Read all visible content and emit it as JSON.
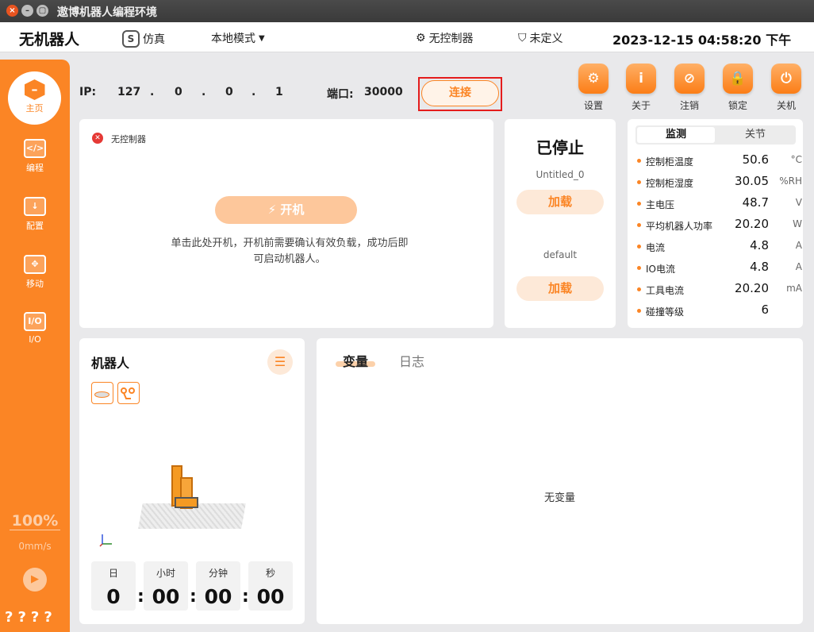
{
  "window": {
    "title": "遨博机器人编程环境",
    "close": "×",
    "minimize": "–",
    "maximize": "▢"
  },
  "header": {
    "brand": "无机器人",
    "sim_badge": "S",
    "sim": "仿真",
    "mode": "本地模式",
    "mode_caret": "▼",
    "controller_icon": "⚙",
    "controller": "无控制器",
    "safety_icon": "⛉",
    "safety": "未定义",
    "datetime": "2023-12-15 04:58:20 下午"
  },
  "sidebar": {
    "home": "主页",
    "home_glyph": "–",
    "items": [
      {
        "label": "编程",
        "glyph": "</>"
      },
      {
        "label": "配置",
        "glyph": "↓"
      },
      {
        "label": "移动",
        "glyph": "✥"
      },
      {
        "label": "I/O",
        "glyph": "I/O"
      }
    ],
    "speed_percent": "100%",
    "speed": "0mm/s",
    "play_glyph": "▶",
    "help": "????"
  },
  "connection": {
    "ip_label": "IP:",
    "ip": [
      "127",
      ".",
      "0",
      ".",
      "0",
      ".",
      "1"
    ],
    "port_label": "端口:",
    "port": "30000",
    "connect_label": "连接"
  },
  "tools": [
    {
      "label": "设置",
      "glyph": "⚙"
    },
    {
      "label": "关于",
      "glyph": "i"
    },
    {
      "label": "注销",
      "glyph": "⊘"
    },
    {
      "label": "锁定",
      "glyph": "🔒"
    },
    {
      "label": "关机",
      "glyph": "⏻"
    }
  ],
  "power_card": {
    "error_glyph": "✕",
    "error": "无控制器",
    "power_label": "⚡ 开机",
    "hint": "单击此处开机，开机前需要确认有效负载，成功后即可启动机器人。"
  },
  "state_card": {
    "state": "已停止",
    "program": "Untitled_0",
    "load1": "加载",
    "config": "default",
    "load2": "加载"
  },
  "monitor": {
    "tab_active": "监测",
    "tab_inactive": "关节",
    "rows": [
      {
        "name": "控制柜温度",
        "value": "50.6",
        "unit": "°C"
      },
      {
        "name": "控制柜湿度",
        "value": "30.05",
        "unit": "%RH"
      },
      {
        "name": "主电压",
        "value": "48.7",
        "unit": "V"
      },
      {
        "name": "平均机器人功率",
        "value": "20.20",
        "unit": "W"
      },
      {
        "name": "电流",
        "value": "4.8",
        "unit": "A"
      },
      {
        "name": "IO电流",
        "value": "4.8",
        "unit": "A"
      },
      {
        "name": "工具电流",
        "value": "20.20",
        "unit": "mA"
      },
      {
        "name": "碰撞等级",
        "value": "6",
        "unit": ""
      }
    ]
  },
  "robot_card": {
    "title": "机器人",
    "list_glyph": "☰",
    "time_labels": [
      "日",
      "小时",
      "分钟",
      "秒"
    ],
    "time_values": [
      "0",
      "00",
      "00",
      "00"
    ],
    "colon": ":"
  },
  "vars_card": {
    "tab_active": "变量",
    "tab_inactive": "日志",
    "empty": "无变量"
  }
}
